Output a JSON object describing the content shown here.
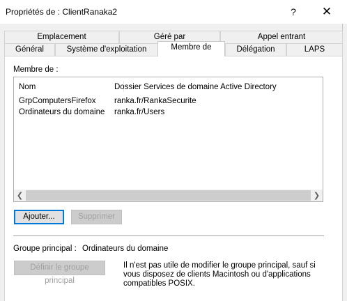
{
  "window": {
    "title": "Propriétés de : ClientRanaka2",
    "help_glyph": "?",
    "close_glyph": "✕"
  },
  "tabs_row1": [
    "Emplacement",
    "Géré par",
    "Appel entrant"
  ],
  "tabs_row2": [
    "Général",
    "Système d'exploitation",
    "Membre de",
    "Délégation",
    "LAPS"
  ],
  "active_tab": "Membre de",
  "member_of": {
    "label": "Membre de :",
    "columns": [
      "Nom",
      "Dossier Services de domaine Active Directory"
    ],
    "rows": [
      {
        "name": "GrpComputersFirefox",
        "folder": "ranka.fr/RankaSecurite"
      },
      {
        "name": "Ordinateurs du domaine",
        "folder": "ranka.fr/Users"
      }
    ]
  },
  "buttons": {
    "add": "Ajouter...",
    "remove": "Supprimer",
    "set_primary": "Définir le groupe principal"
  },
  "primary_group": {
    "label": "Groupe principal :",
    "value": "Ordinateurs du domaine",
    "info": "Il n'est pas utile de modifier le groupe principal, sauf si vous disposez de clients Macintosh ou d'applications compatibles POSIX."
  },
  "colors": {
    "focus_border": "#0078d7",
    "panel_bg": "#ffffff",
    "dialog_bg": "#f0f0f0"
  }
}
